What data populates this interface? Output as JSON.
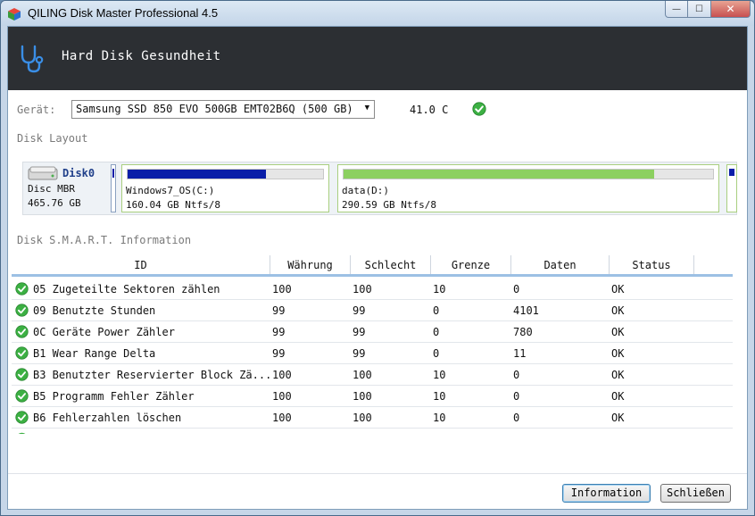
{
  "window": {
    "title": "QILING Disk Master Professional 4.5",
    "min_glyph": "—",
    "max_glyph": "☐",
    "close_glyph": "✕"
  },
  "header": {
    "title": "Hard Disk Gesundheit",
    "icon": "stethoscope-icon",
    "background": "#2c2f33",
    "icon_color": "#3a8ee6"
  },
  "device": {
    "label": "Gerät:",
    "selected": "Samsung SSD 850 EVO 500GB EMT02B6Q (500 GB)",
    "temperature": "41.0 C"
  },
  "disk_layout": {
    "label": "Disk Layout",
    "disk": {
      "name": "Disk0",
      "type": "Disc MBR",
      "size": "465.76 GB"
    },
    "partitions": [
      {
        "name": "Windows7_OS(C:)",
        "info": "160.04 GB Ntfs/8",
        "used_fraction": 0.71,
        "color": "#0a1ea8"
      },
      {
        "name": "data(D:)",
        "info": "290.59 GB Ntfs/8",
        "used_fraction": 0.84,
        "color": "#8cd060"
      }
    ]
  },
  "smart": {
    "label": "Disk S.M.A.R.T. Information",
    "columns": [
      "ID",
      "Währung",
      "Schlecht",
      "Grenze",
      "Daten",
      "Status"
    ],
    "rows": [
      {
        "id": "05 Zugeteilte Sektoren zählen",
        "current": "100",
        "worst": "100",
        "threshold": "10",
        "data": "0",
        "status": "OK"
      },
      {
        "id": "09 Benutzte Stunden",
        "current": "99",
        "worst": "99",
        "threshold": "0",
        "data": "4101",
        "status": "OK"
      },
      {
        "id": "0C Geräte Power Zähler",
        "current": "99",
        "worst": "99",
        "threshold": "0",
        "data": "780",
        "status": "OK"
      },
      {
        "id": "B1 Wear Range Delta",
        "current": "99",
        "worst": "99",
        "threshold": "0",
        "data": "11",
        "status": "OK"
      },
      {
        "id": "B3 Benutzter Reservierter Block Zä...",
        "current": "100",
        "worst": "100",
        "threshold": "10",
        "data": "0",
        "status": "OK"
      },
      {
        "id": "B5 Programm Fehler Zähler",
        "current": "100",
        "worst": "100",
        "threshold": "10",
        "data": "0",
        "status": "OK"
      },
      {
        "id": "B6 Fehlerzahlen löschen",
        "current": "100",
        "worst": "100",
        "threshold": "10",
        "data": "0",
        "status": "OK"
      }
    ]
  },
  "buttons": {
    "info": "Information",
    "close": "Schließen"
  },
  "colors": {
    "ok_green": "#3cb043",
    "partition_border": "#a9cf7f"
  }
}
